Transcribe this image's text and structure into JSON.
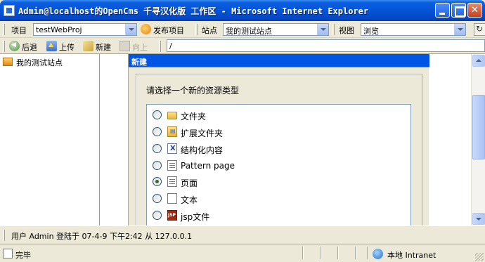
{
  "window": {
    "title": "Admin@localhost的OpenCms 千寻汉化版 工作区 - Microsoft Internet Explorer"
  },
  "toolbar1": {
    "project_label": "项目",
    "project_value": "testWebProj",
    "publish_label": "发布项目",
    "site_label": "站点",
    "site_value": "我的测试站点",
    "view_label": "视图",
    "view_value": "浏览"
  },
  "toolbar2": {
    "back_label": "后退",
    "upload_label": "上传",
    "new_label": "新建",
    "up_label": "向上",
    "address_value": "/"
  },
  "tree": {
    "root_label": "我的测试站点"
  },
  "dialog": {
    "title": "新建",
    "prompt": "请选择一个新的资源类型",
    "options": [
      {
        "label": "文件夹",
        "icon": "folder-icon",
        "selected": false
      },
      {
        "label": "扩展文件夹",
        "icon": "extended-folder-icon",
        "selected": false
      },
      {
        "label": "结构化内容",
        "icon": "structured-content-icon",
        "selected": false
      },
      {
        "label": "Pattern page",
        "icon": "page-icon",
        "selected": false
      },
      {
        "label": "页面",
        "icon": "page-icon",
        "selected": true
      },
      {
        "label": "文本",
        "icon": "text-file-icon",
        "selected": false
      },
      {
        "label": "jsp文件",
        "icon": "jsp-file-icon",
        "selected": false
      }
    ]
  },
  "infobar": {
    "text": "用户 Admin 登陆于 07-4-9 下午2:42 从 127.0.0.1"
  },
  "statusbar": {
    "status": "完毕",
    "zone": "本地 Intranet"
  }
}
